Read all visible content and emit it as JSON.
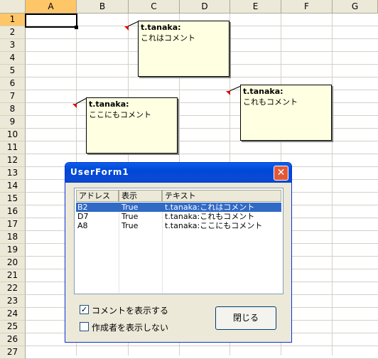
{
  "sheet": {
    "columns": [
      "A",
      "B",
      "C",
      "D",
      "E",
      "F",
      "G"
    ],
    "rows": [
      "1",
      "2",
      "3",
      "4",
      "5",
      "6",
      "7",
      "8",
      "9",
      "10",
      "11",
      "12",
      "13",
      "14",
      "15",
      "16",
      "17",
      "18",
      "19",
      "20",
      "21",
      "22",
      "23",
      "24",
      "25",
      "26",
      "27"
    ],
    "selected_column": "A",
    "selected_row": "1"
  },
  "comments": [
    {
      "author": "t.tanaka:",
      "text": "これはコメント"
    },
    {
      "author": "t.tanaka:",
      "text": "これもコメント"
    },
    {
      "author": "t.tanaka:",
      "text": "ここにもコメント"
    }
  ],
  "userform": {
    "title": "UserForm1",
    "close_glyph": "✕",
    "listbox": {
      "headers": [
        "アドレス",
        "表示",
        "テキスト"
      ],
      "rows": [
        [
          "B2",
          "True",
          "t.tanaka:これはコメント"
        ],
        [
          "D7",
          "True",
          "t.tanaka:これもコメント"
        ],
        [
          "A8",
          "True",
          "t.tanaka:ここにもコメント"
        ]
      ],
      "selected_row": 0
    },
    "checkboxes": [
      {
        "label": "コメントを表示する",
        "checked": true,
        "mark": "✓"
      },
      {
        "label": "作成者を表示しない",
        "checked": false,
        "mark": ""
      }
    ],
    "close_button_label": "閉じる"
  }
}
